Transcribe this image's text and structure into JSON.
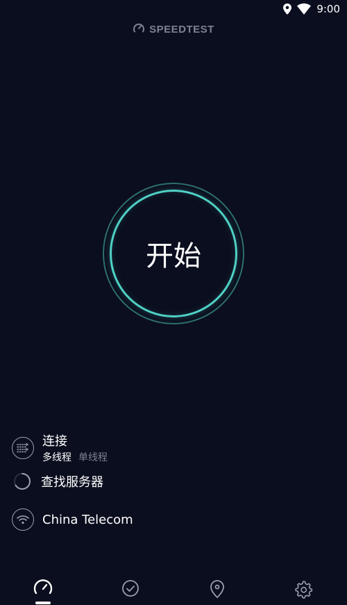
{
  "status_bar": {
    "time": "9:00"
  },
  "brand": {
    "name": "SPEEDTEST"
  },
  "start": {
    "label": "开始"
  },
  "connection": {
    "label": "连接",
    "options": [
      "多线程",
      "单线程"
    ],
    "selected": "多线程"
  },
  "server": {
    "label": "查找服务器"
  },
  "provider": {
    "name": "China Telecom"
  },
  "colors": {
    "background": "#0b0e1e",
    "accent": "#4fd1c5",
    "muted": "#7d8194"
  },
  "nav": {
    "items": [
      {
        "icon": "speedometer-icon"
      },
      {
        "icon": "checkmark-circle-icon"
      },
      {
        "icon": "location-pin-icon"
      },
      {
        "icon": "gear-icon"
      }
    ]
  }
}
